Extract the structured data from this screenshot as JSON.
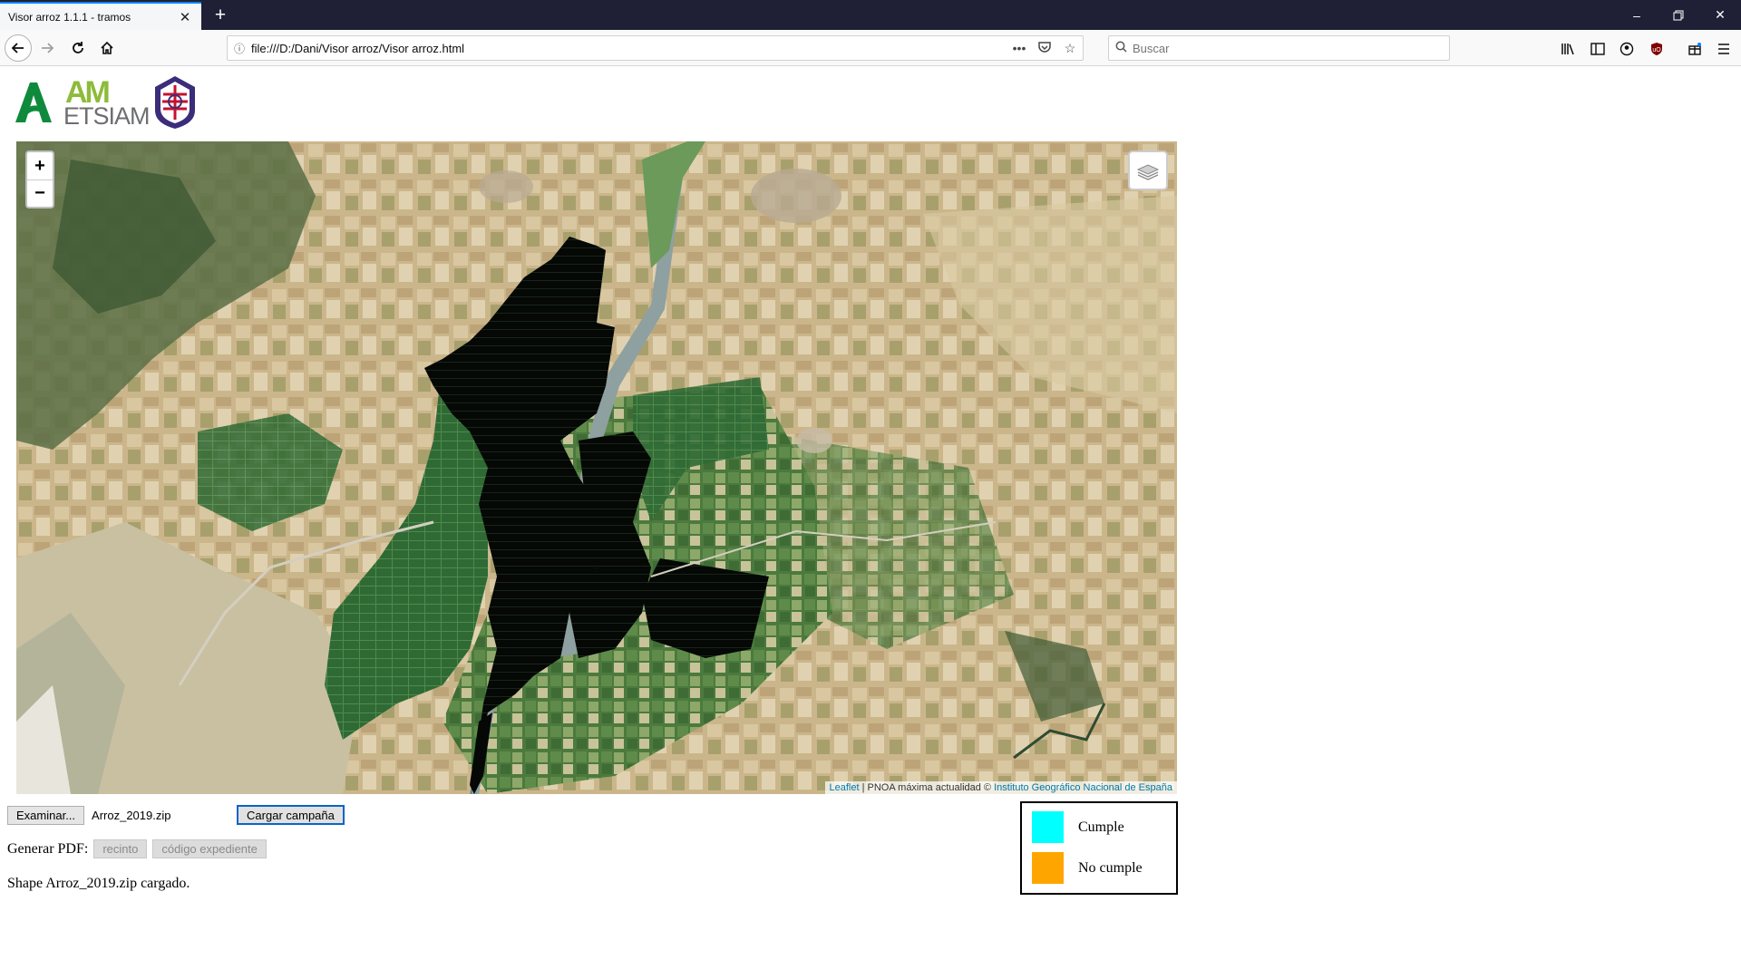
{
  "browser": {
    "tab_title": "Visor arroz 1.1.1 - tramos",
    "url": "file:///D:/Dani/Visor arroz/Visor arroz.html",
    "search_placeholder": "Buscar"
  },
  "map": {
    "zoom_in": "+",
    "zoom_out": "−",
    "attribution": {
      "leaflet": "Leaflet",
      "separator": " | ",
      "pnoa": "PNOA máxima actualidad © ",
      "ign": "Instituto Geográfico Nacional de España"
    }
  },
  "controls": {
    "browse_label": "Examinar...",
    "file_name": "Arroz_2019.zip",
    "load_label": "Cargar campaña",
    "pdf_label": "Generar PDF:",
    "recinto_label": "recinto",
    "expediente_label": "código expediente",
    "status": "Shape Arroz_2019.zip cargado."
  },
  "legend": {
    "items": [
      {
        "label": "Cumple",
        "color": "#00ffff"
      },
      {
        "label": "No cumple",
        "color": "#ffa500"
      }
    ]
  },
  "colors": {
    "accent": "#0a84ff",
    "chrome_dark": "#1f2036",
    "leaflet_link": "#0078a8"
  }
}
